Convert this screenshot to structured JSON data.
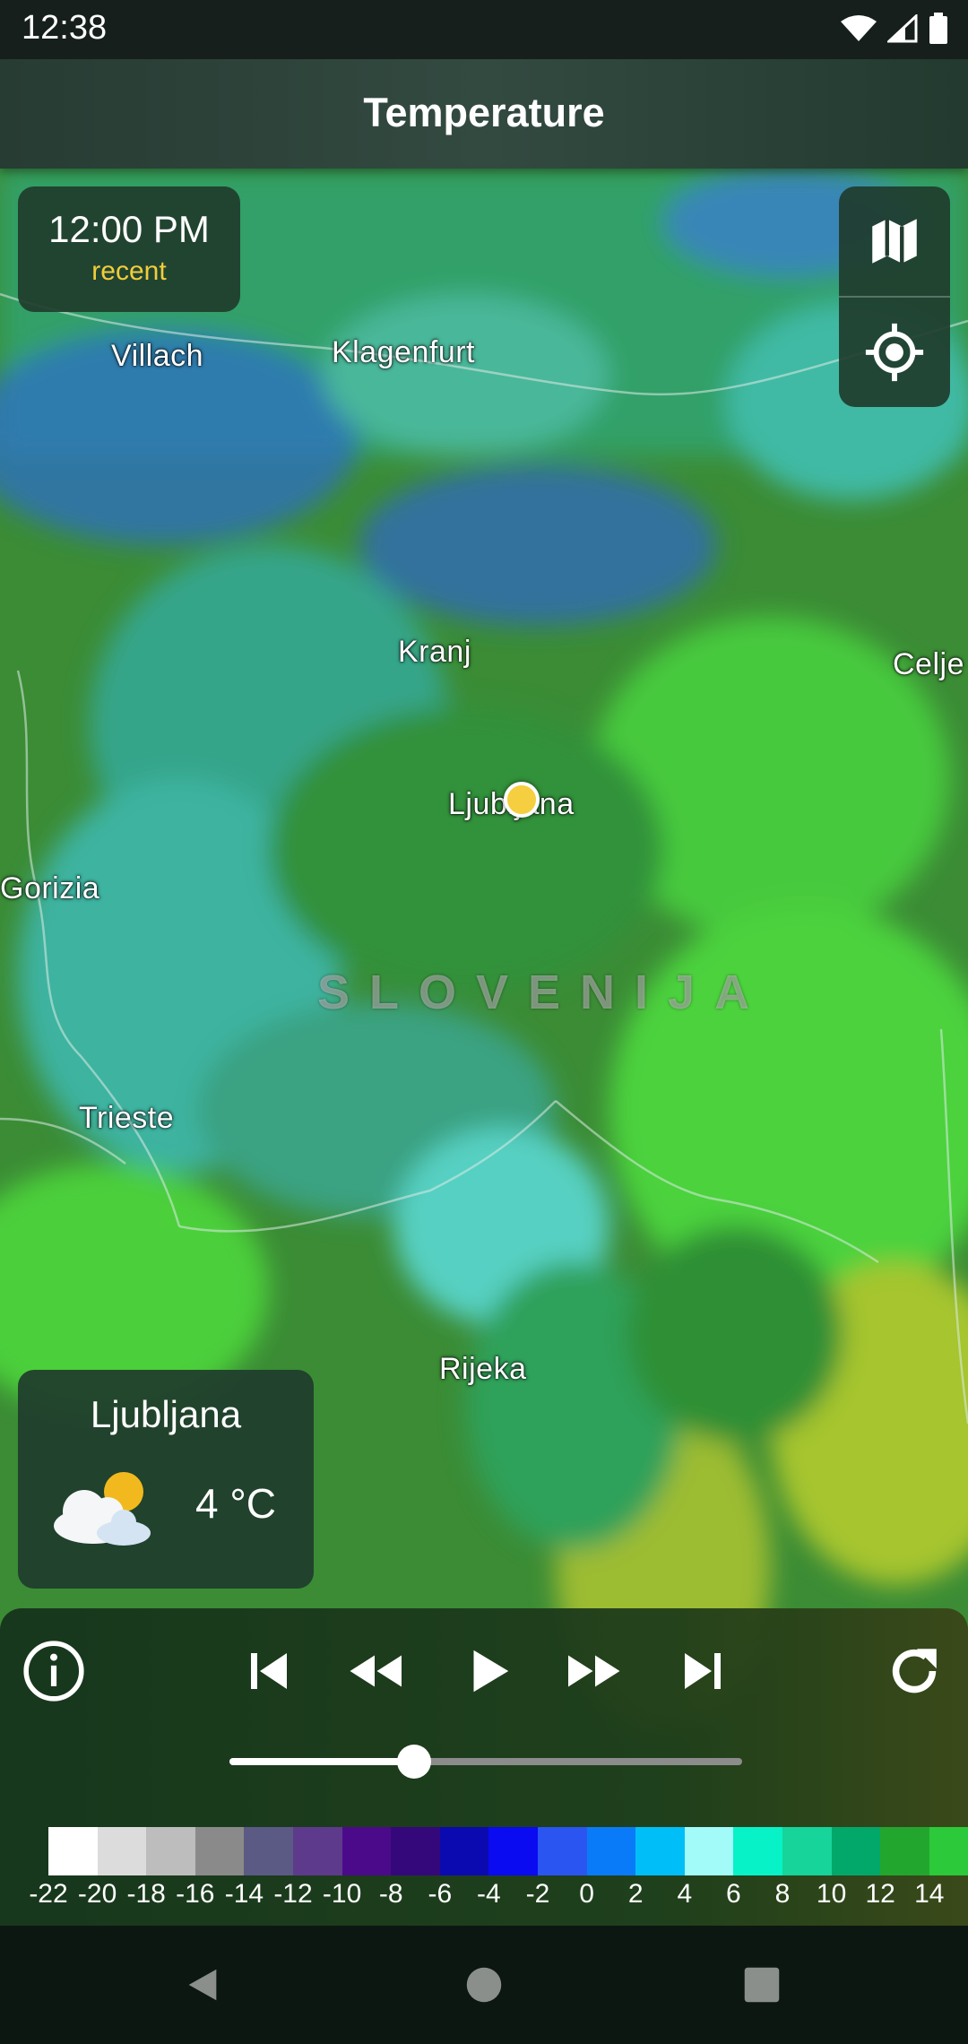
{
  "status_bar": {
    "time": "12:38"
  },
  "app_bar": {
    "title": "Temperature"
  },
  "time_card": {
    "time": "12:00 PM",
    "label": "recent"
  },
  "map": {
    "places": [
      {
        "name": "Villach"
      },
      {
        "name": "Klagenfurt"
      },
      {
        "name": "Kranj"
      },
      {
        "name": "Celje"
      },
      {
        "name": "Ljubljana"
      },
      {
        "name": "Gorizia"
      },
      {
        "name": "Trieste"
      },
      {
        "name": "Rijeka"
      }
    ],
    "country_label": "SLOVENIJA"
  },
  "weather_card": {
    "city": "Ljubljana",
    "temperature": "4 °C",
    "icon": "partly-cloudy-icon"
  },
  "playback": {
    "buttons": [
      "info-icon",
      "skip-to-start-icon",
      "rewind-icon",
      "play-icon",
      "fast-forward-icon",
      "skip-to-end-icon",
      "refresh-icon"
    ],
    "progress": 0.36
  },
  "legend": {
    "colors": [
      "#ffffff",
      "#dcdcdc",
      "#bdbdbd",
      "#8a8a8a",
      "#5b5a85",
      "#5e3a8c",
      "#4b0a8a",
      "#34087a",
      "#0b0ab0",
      "#0a0bf0",
      "#2b55f0",
      "#0a7bf8",
      "#00bff8",
      "#a2fbf8",
      "#08f2c8",
      "#16d49a",
      "#02a86a",
      "#23a62e",
      "#2cc93a"
    ],
    "labels": [
      "-22",
      "-20",
      "-18",
      "-16",
      "-14",
      "-12",
      "-10",
      "-8",
      "-6",
      "-4",
      "-2",
      "0",
      "2",
      "4",
      "6",
      "8",
      "10",
      "12",
      "14"
    ]
  }
}
